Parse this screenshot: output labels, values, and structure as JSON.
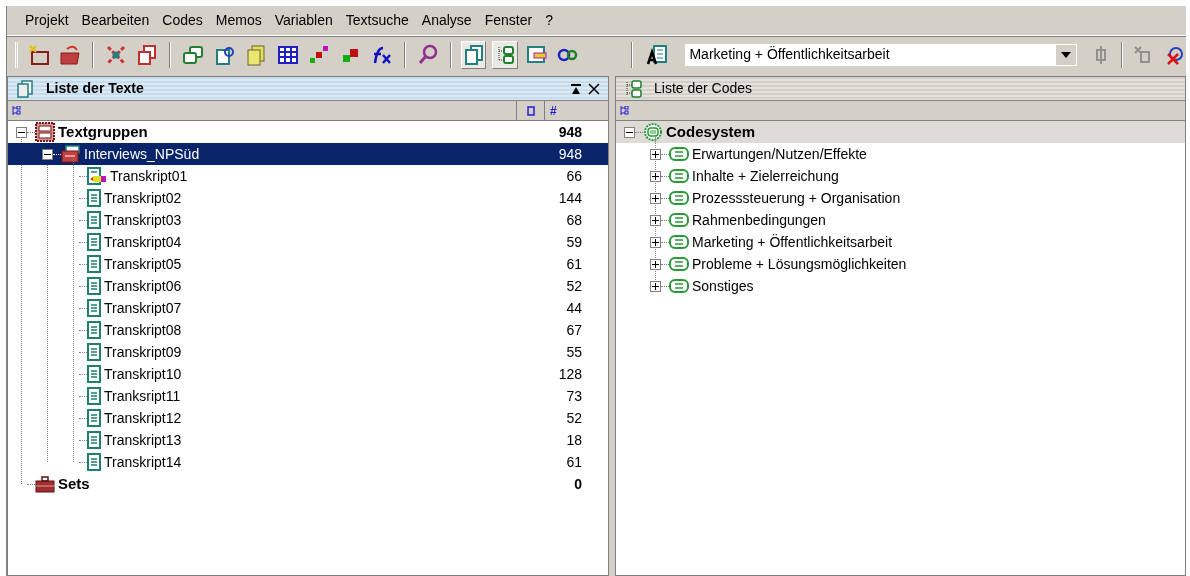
{
  "menu": [
    "Projekt",
    "Bearbeiten",
    "Codes",
    "Memos",
    "Variablen",
    "Textsuche",
    "Analyse",
    "Fenster",
    "?"
  ],
  "code_selector": {
    "value": "Marketing + Öffentlichkeitsarbeit"
  },
  "text_panel": {
    "title": "Liste der Texte",
    "column_2": "#",
    "tree": [
      {
        "label": "Textgruppen",
        "count": "948",
        "kind": "root",
        "expanded": true,
        "selected": false,
        "children": [
          {
            "label": "Interviews_NPSüd",
            "count": "948",
            "kind": "group",
            "expanded": true,
            "selected": true,
            "children": [
              {
                "label": "Transkript01",
                "count": "66",
                "kind": "text_memo",
                "selected": false
              },
              {
                "label": "Transkript02",
                "count": "144",
                "kind": "text",
                "selected": false
              },
              {
                "label": "Transkript03",
                "count": "68",
                "kind": "text",
                "selected": false
              },
              {
                "label": "Transkript04",
                "count": "59",
                "kind": "text",
                "selected": false
              },
              {
                "label": "Transkript05",
                "count": "61",
                "kind": "text",
                "selected": false
              },
              {
                "label": "Transkript06",
                "count": "52",
                "kind": "text",
                "selected": false
              },
              {
                "label": "Transkript07",
                "count": "44",
                "kind": "text",
                "selected": false
              },
              {
                "label": "Transkript08",
                "count": "67",
                "kind": "text",
                "selected": false
              },
              {
                "label": "Transkript09",
                "count": "55",
                "kind": "text",
                "selected": false
              },
              {
                "label": "Transkript10",
                "count": "128",
                "kind": "text",
                "selected": false
              },
              {
                "label": "Tranksript11",
                "count": "73",
                "kind": "text",
                "selected": false
              },
              {
                "label": "Transkript12",
                "count": "52",
                "kind": "text",
                "selected": false
              },
              {
                "label": "Transkript13",
                "count": "18",
                "kind": "text",
                "selected": false
              },
              {
                "label": "Transkript14",
                "count": "61",
                "kind": "text",
                "selected": false
              }
            ]
          }
        ]
      },
      {
        "label": "Sets",
        "count": "0",
        "kind": "sets",
        "selected": false
      }
    ]
  },
  "code_panel": {
    "title": "Liste der Codes",
    "tree": [
      {
        "label": "Codesystem",
        "kind": "root",
        "expanded": true,
        "selected": false,
        "children": [
          {
            "label": "Erwartungen/Nutzen/Effekte",
            "kind": "code",
            "expanded": false,
            "selected": false
          },
          {
            "label": "Inhalte + Zielerreichung",
            "kind": "code",
            "expanded": false,
            "selected": false
          },
          {
            "label": "Prozesssteuerung + Organisation",
            "kind": "code",
            "expanded": false,
            "selected": false
          },
          {
            "label": "Rahmenbedingungen",
            "kind": "code",
            "expanded": false,
            "selected": false
          },
          {
            "label": "Marketing + Öffentlichkeitsarbeit",
            "kind": "code",
            "expanded": false,
            "selected": false
          },
          {
            "label": "Probleme + Lösungsmöglichkeiten",
            "kind": "code",
            "expanded": false,
            "selected": false
          },
          {
            "label": "Sonstiges",
            "kind": "code",
            "expanded": false,
            "selected": false
          }
        ]
      }
    ]
  }
}
